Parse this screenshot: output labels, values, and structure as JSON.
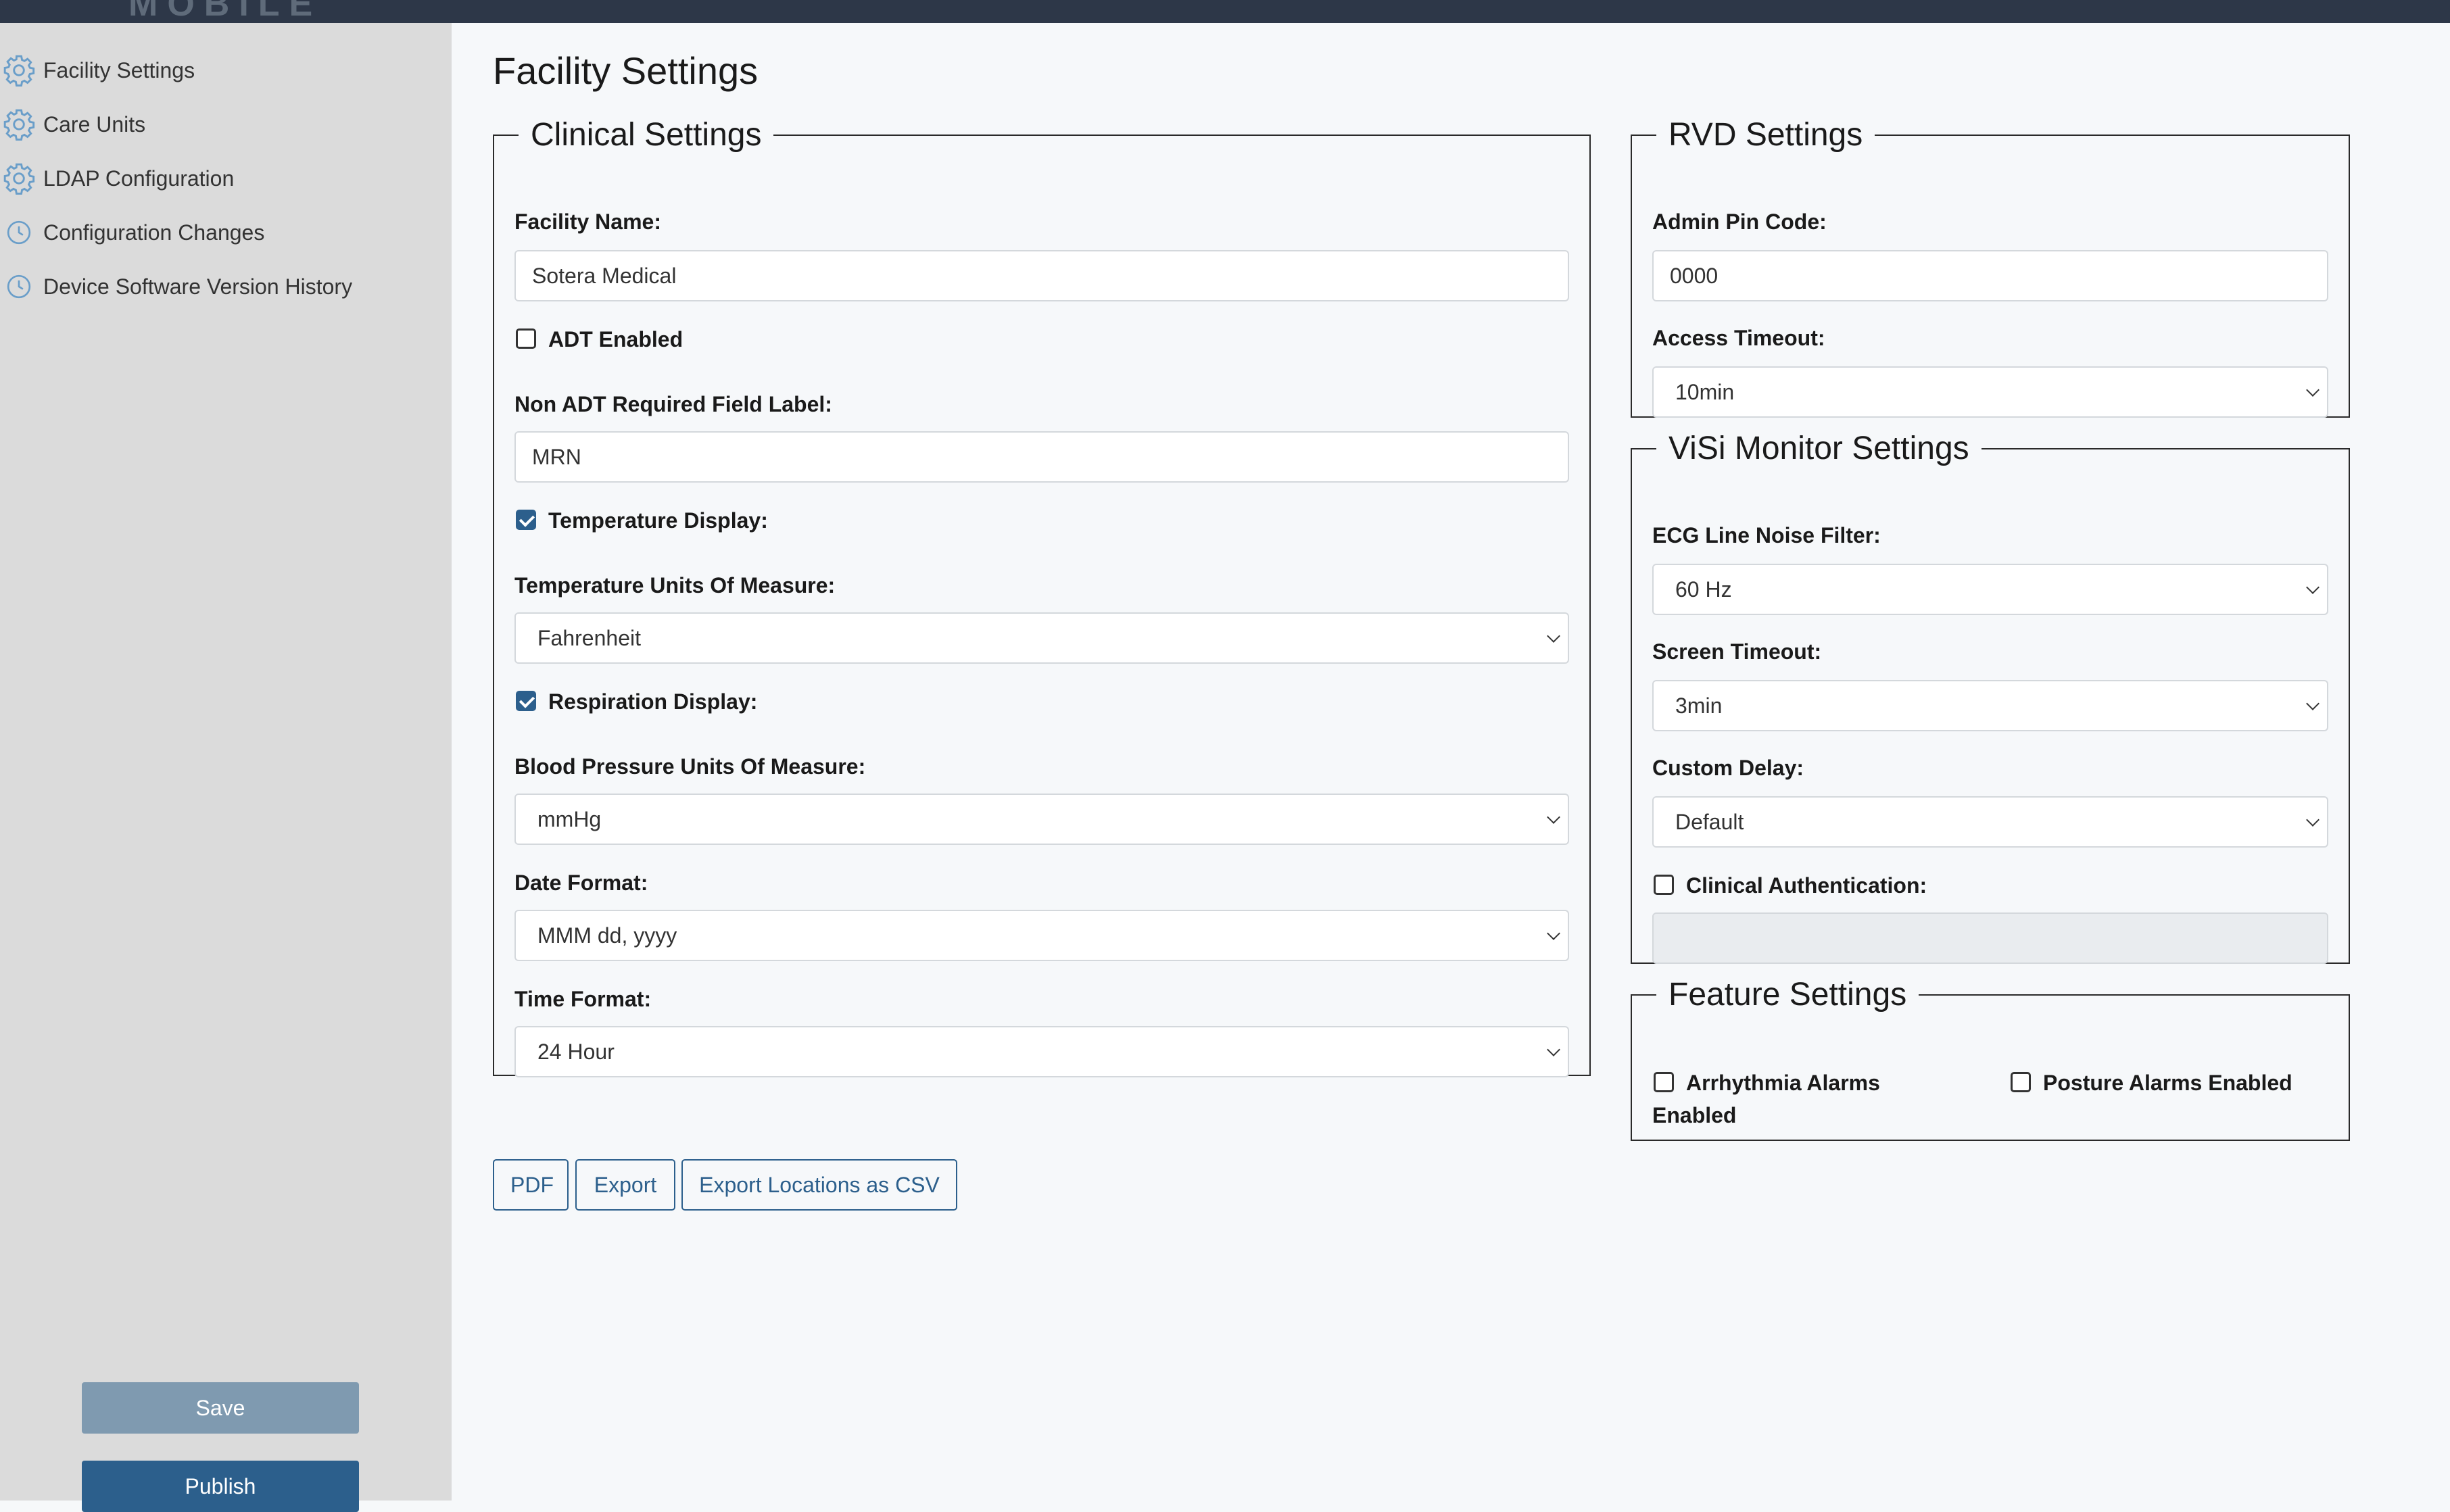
{
  "app": {
    "logo_text": "MOBILE"
  },
  "sidebar": {
    "items": [
      {
        "label": "Facility Settings",
        "icon": "gear-icon"
      },
      {
        "label": "Care Units",
        "icon": "gear-icon"
      },
      {
        "label": "LDAP Configuration",
        "icon": "gear-icon"
      },
      {
        "label": "Configuration Changes",
        "icon": "clock-icon"
      },
      {
        "label": "Device Software Version History",
        "icon": "clock-icon"
      }
    ],
    "save_label": "Save",
    "publish_label": "Publish"
  },
  "page": {
    "title": "Facility Settings"
  },
  "clinical": {
    "legend": "Clinical Settings",
    "facility_name_label": "Facility Name:",
    "facility_name_value": "Sotera Medical",
    "adt_enabled_label": "ADT Enabled",
    "adt_enabled_checked": false,
    "non_adt_label": "Non ADT Required Field Label:",
    "non_adt_value": "MRN",
    "temp_display_label": "Temperature Display:",
    "temp_display_checked": true,
    "temp_units_label": "Temperature Units Of Measure:",
    "temp_units_value": "Fahrenheit",
    "resp_display_label": "Respiration Display:",
    "resp_display_checked": true,
    "bp_units_label": "Blood Pressure Units Of Measure:",
    "bp_units_value": "mmHg",
    "date_format_label": "Date Format:",
    "date_format_value": "MMM dd, yyyy",
    "time_format_label": "Time Format:",
    "time_format_value": "24 Hour"
  },
  "rvd": {
    "legend": "RVD Settings",
    "admin_pin_label": "Admin Pin Code:",
    "admin_pin_value": "0000",
    "access_timeout_label": "Access Timeout:",
    "access_timeout_value": "10min"
  },
  "visi": {
    "legend": "ViSi Monitor Settings",
    "ecg_label": "ECG Line Noise Filter:",
    "ecg_value": "60 Hz",
    "screen_timeout_label": "Screen Timeout:",
    "screen_timeout_value": "3min",
    "custom_delay_label": "Custom Delay:",
    "custom_delay_value": "Default",
    "clinical_auth_label": "Clinical Authentication:",
    "clinical_auth_checked": false,
    "clinical_auth_value": ""
  },
  "feature": {
    "legend": "Feature Settings",
    "arrhythmia_label_line1": "Arrhythmia Alarms",
    "arrhythmia_label_line2": "Enabled",
    "arrhythmia_checked": false,
    "posture_label": "Posture Alarms Enabled",
    "posture_checked": false
  },
  "actions": {
    "pdf_label": "PDF",
    "export_label": "Export",
    "export_csv_label": "Export Locations as CSV"
  },
  "colors": {
    "accent": "#2c5f8c",
    "save_button": "#7f9ab0",
    "topbar": "#2d3748",
    "sidebar_bg": "#dbdbdb",
    "icon": "#6a9ec9"
  }
}
